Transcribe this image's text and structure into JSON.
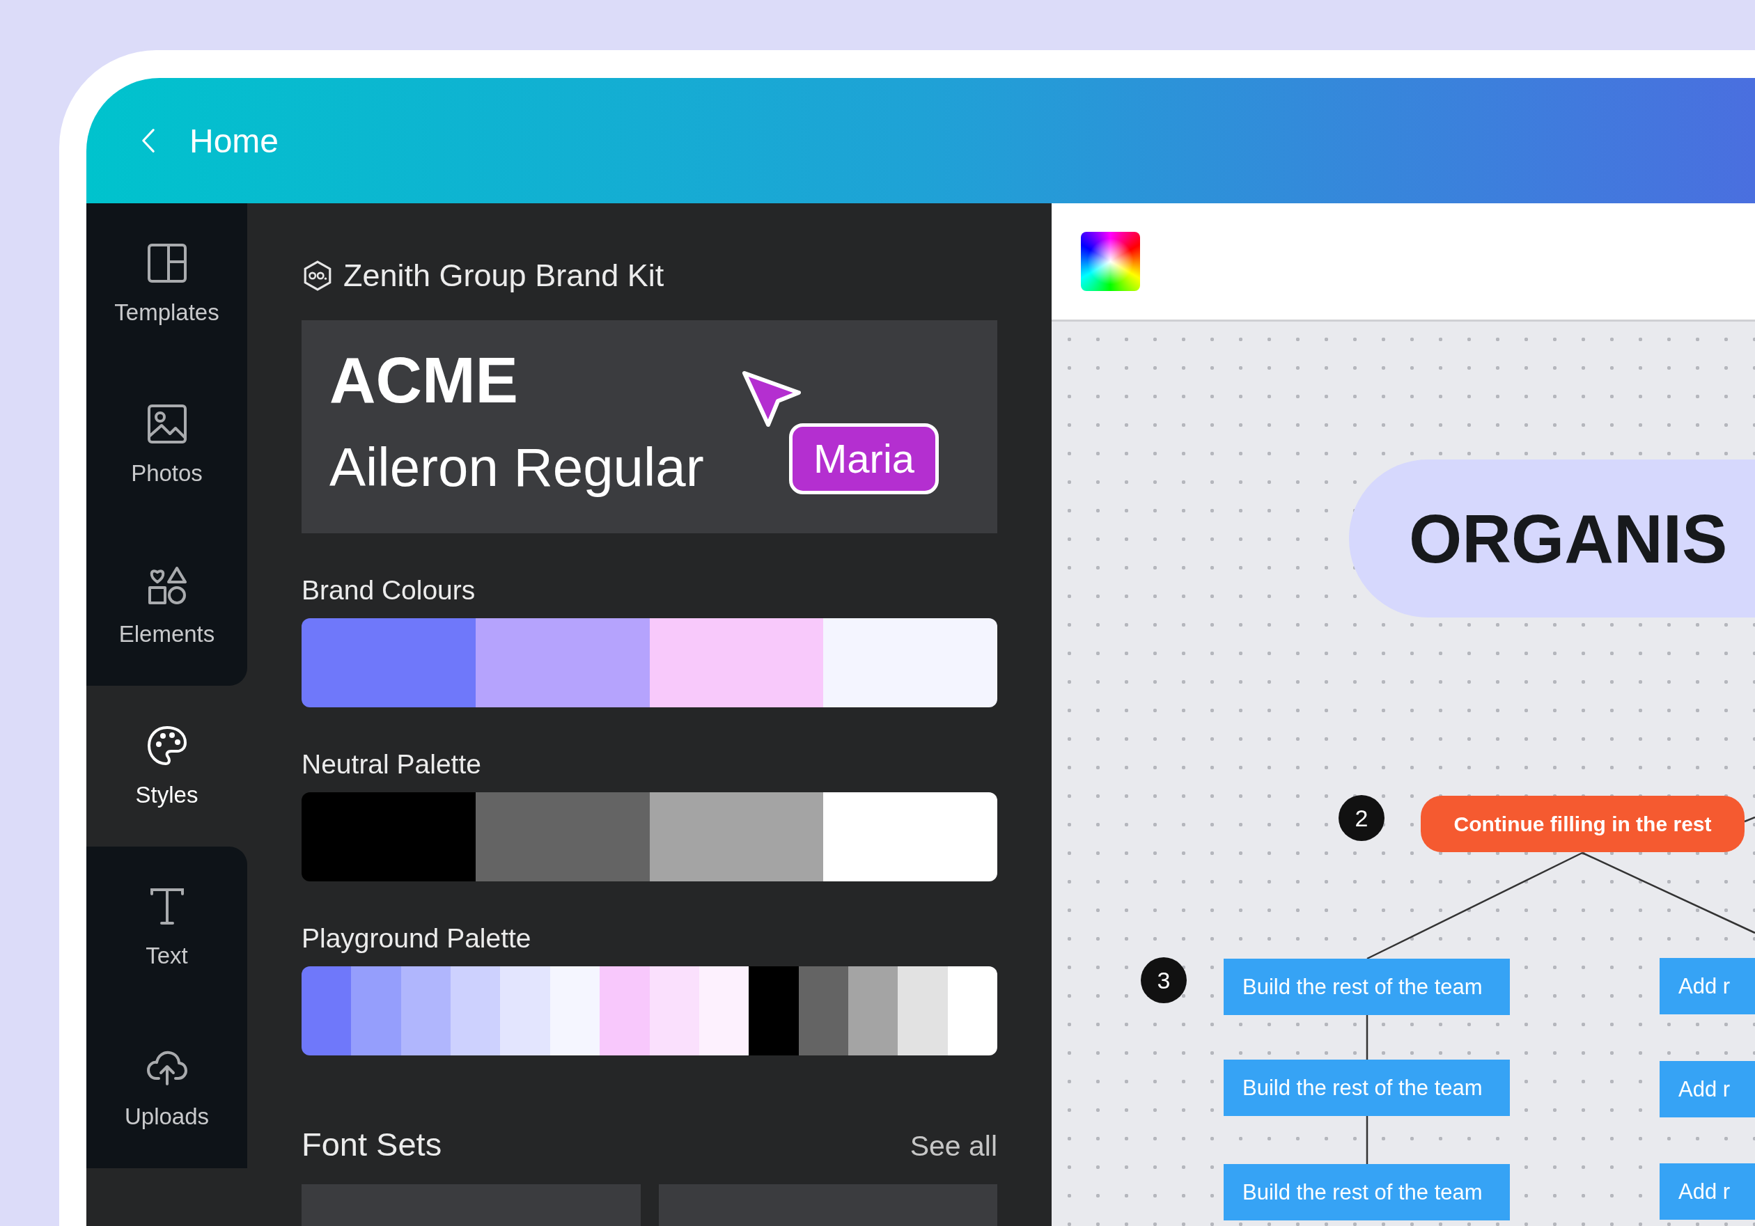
{
  "header": {
    "back_label": "Home"
  },
  "sidebar": {
    "items": [
      {
        "label": "Templates",
        "kind": "templates",
        "selected": false
      },
      {
        "label": "Photos",
        "kind": "photos",
        "selected": false
      },
      {
        "label": "Elements",
        "kind": "elements",
        "selected": false
      },
      {
        "label": "Styles",
        "kind": "styles",
        "selected": true
      },
      {
        "label": "Text",
        "kind": "text",
        "selected": false
      },
      {
        "label": "Uploads",
        "kind": "uploads",
        "selected": false
      }
    ]
  },
  "brand_kit": {
    "title": "Zenith Group Brand Kit",
    "font_preview": {
      "heading": "ACME",
      "body": "Aileron Regular"
    },
    "collaborator": {
      "name": "Maria",
      "color": "#b42fd0"
    }
  },
  "palettes": [
    {
      "name": "Brand Colours",
      "swatches": [
        {
          "color": "#6f78fa"
        },
        {
          "color": "#b5a3fd"
        },
        {
          "color": "#f8c9fb"
        },
        {
          "color": "#f4f5ff"
        }
      ]
    },
    {
      "name": "Neutral Palette",
      "swatches": [
        {
          "color": "#000000"
        },
        {
          "color": "#646464"
        },
        {
          "color": "#a4a4a4"
        },
        {
          "color": "#ffffff"
        }
      ]
    },
    {
      "name": "Playground Palette",
      "swatches": [
        {
          "color": "#6f78fa"
        },
        {
          "color": "#959efc"
        },
        {
          "color": "#b0b6fd"
        },
        {
          "color": "#cdd1fe"
        },
        {
          "color": "#e3e5fe"
        },
        {
          "color": "#f5f6ff"
        },
        {
          "color": "#f8c8fc"
        },
        {
          "color": "#fae0fd"
        },
        {
          "color": "#fdf1fe"
        },
        {
          "color": "#000000"
        },
        {
          "color": "#646464"
        },
        {
          "color": "#a4a4a4"
        },
        {
          "color": "#e2e2e2"
        },
        {
          "color": "#ffffff"
        }
      ]
    }
  ],
  "font_sets": {
    "title": "Font Sets",
    "link": "See all"
  },
  "canvas": {
    "heading": "ORGANIS",
    "badges": [
      "2",
      "3"
    ],
    "nodes": [
      {
        "text": "Continue filling in the rest",
        "kind": "primary"
      },
      {
        "text": "Build the rest of the team",
        "kind": "member"
      },
      {
        "text": "Build the rest of the team",
        "kind": "member"
      },
      {
        "text": "Build the rest of the team",
        "kind": "member"
      },
      {
        "text": "Add r",
        "kind": "member"
      },
      {
        "text": "Add r",
        "kind": "member"
      },
      {
        "text": "Add r",
        "kind": "member"
      }
    ]
  }
}
